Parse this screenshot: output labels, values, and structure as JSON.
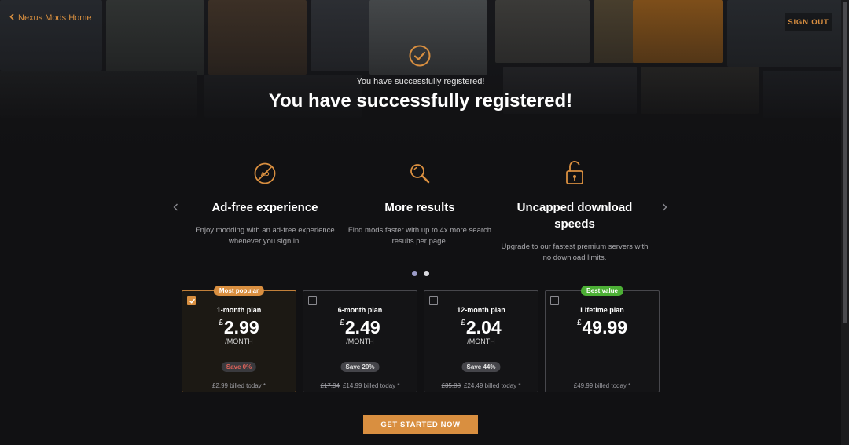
{
  "nav": {
    "home_link": "Nexus Mods Home",
    "sign_out": "SIGN OUT"
  },
  "hero": {
    "subtitle": "You have successfully registered!",
    "title": "You have successfully registered!"
  },
  "features": [
    {
      "icon": "ad-block-icon",
      "title": "Ad-free experience",
      "description": "Enjoy modding with an ad-free experience whenever you sign in."
    },
    {
      "icon": "magnifier-icon",
      "title": "More results",
      "description": "Find mods faster with up to 4x more search results per page."
    },
    {
      "icon": "unlock-icon",
      "title": "Uncapped download speeds",
      "description": "Upgrade to our fastest premium servers with no download limits."
    }
  ],
  "carousel": {
    "pages": 2,
    "active_page": 1
  },
  "plans": [
    {
      "badge": "Most popular",
      "name": "1-month plan",
      "currency": "£",
      "price": "2.99",
      "per": "/MONTH",
      "save": "Save 0%",
      "billed_old": "",
      "billed": "£2.99 billed today *",
      "selected": true
    },
    {
      "badge": "",
      "name": "6-month plan",
      "currency": "£",
      "price": "2.49",
      "per": "/MONTH",
      "save": "Save 20%",
      "billed_old": "£17.94",
      "billed": "£14.99 billed today *",
      "selected": false
    },
    {
      "badge": "",
      "name": "12-month plan",
      "currency": "£",
      "price": "2.04",
      "per": "/MONTH",
      "save": "Save 44%",
      "billed_old": "£35.88",
      "billed": "£24.49 billed today *",
      "selected": false
    },
    {
      "badge": "Best value",
      "name": "Lifetime plan",
      "currency": "£",
      "price": "49.99",
      "per": "",
      "save": "",
      "billed_old": "",
      "billed": "£49.99 billed today *",
      "selected": false
    }
  ],
  "cta": "GET STARTED NOW",
  "colors": {
    "accent": "#d98f40",
    "background": "#111113",
    "best_value": "#4caf35",
    "save_zero": "#e0635a"
  }
}
